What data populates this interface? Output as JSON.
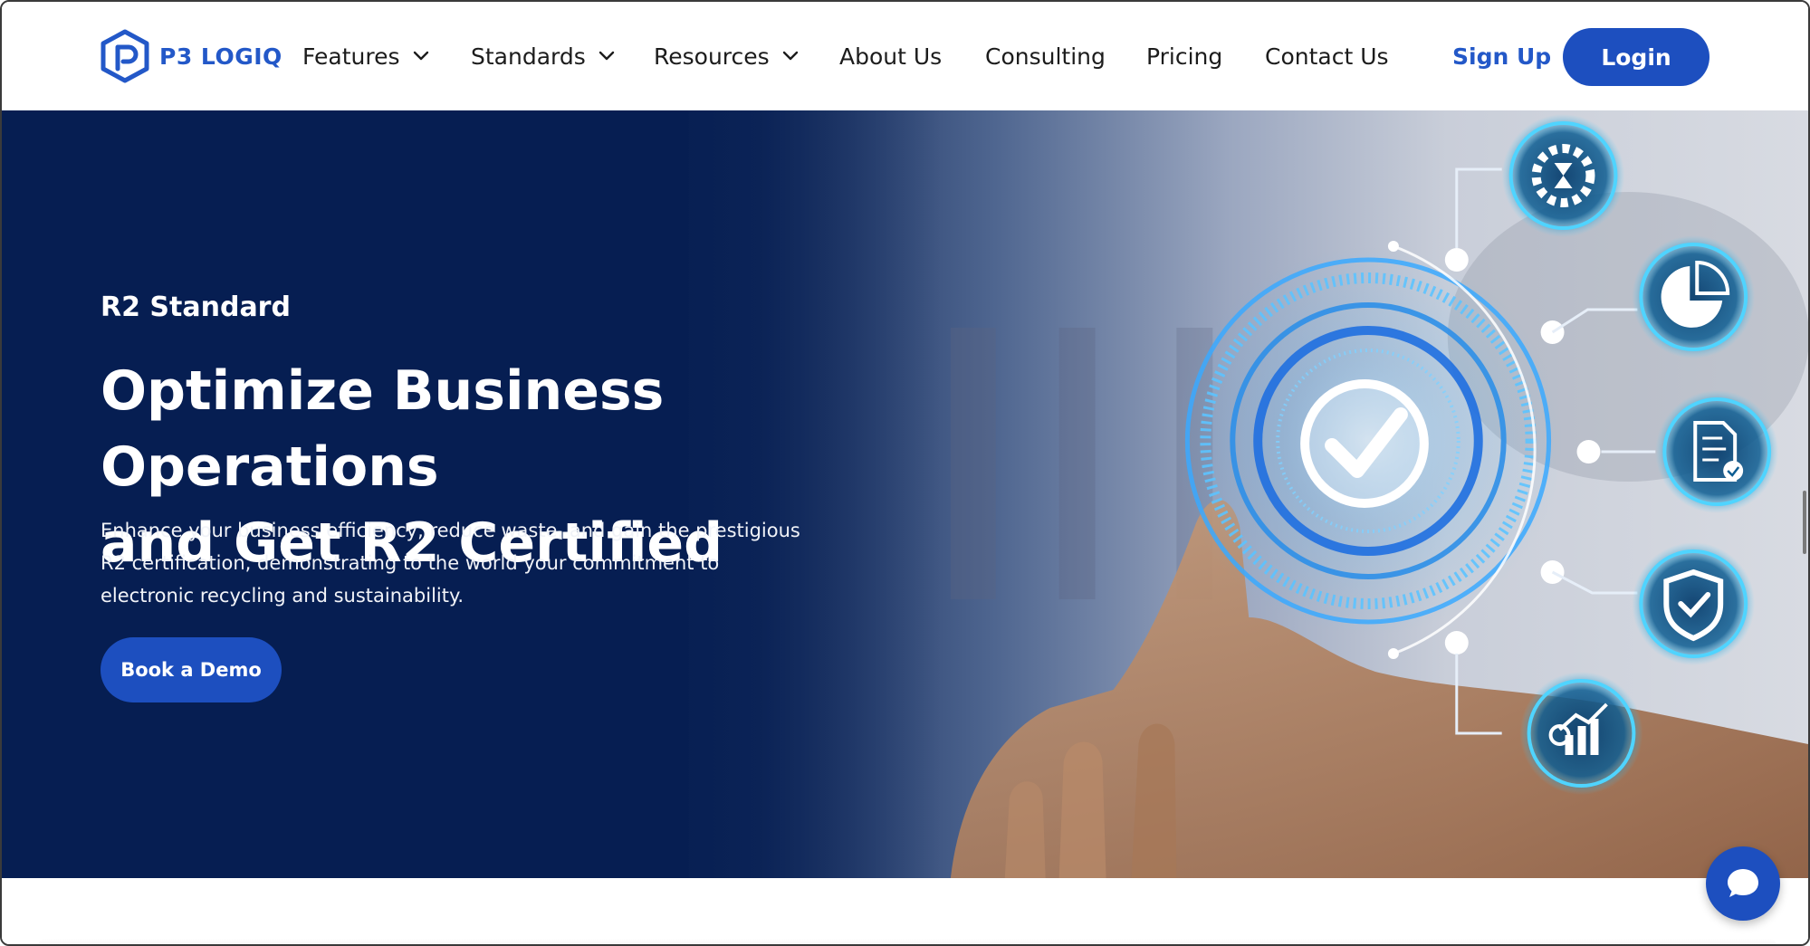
{
  "brand": {
    "name": "P3 LOGIQ",
    "color": "#2358c8"
  },
  "nav": {
    "items": [
      {
        "label": "Features",
        "dropdown": true
      },
      {
        "label": "Standards",
        "dropdown": true
      },
      {
        "label": "Resources",
        "dropdown": true
      },
      {
        "label": "About Us",
        "dropdown": false
      },
      {
        "label": "Consulting",
        "dropdown": false
      },
      {
        "label": "Pricing",
        "dropdown": false
      },
      {
        "label": "Contact Us",
        "dropdown": false
      }
    ],
    "signup_label": "Sign Up",
    "login_label": "Login"
  },
  "hero": {
    "eyebrow": "R2 Standard",
    "headline_line1": "Optimize Business Operations",
    "headline_line2": "and Get R2 Certified",
    "subtext": "Enhance your business efficiency, reduce waste, and gain the prestigious R2 certification, demonstrating to the world your commitment to electronic recycling and sustainability.",
    "cta_label": "Book a Demo",
    "icons": [
      "gear-hourglass-icon",
      "pie-chart-icon",
      "document-check-icon",
      "shield-check-icon",
      "growth-chart-icon",
      "checkmark-icon"
    ]
  },
  "colors": {
    "primary": "#1d4fbf",
    "hero_dark": "#041b4f",
    "accent_glow": "#3fb7ff"
  }
}
